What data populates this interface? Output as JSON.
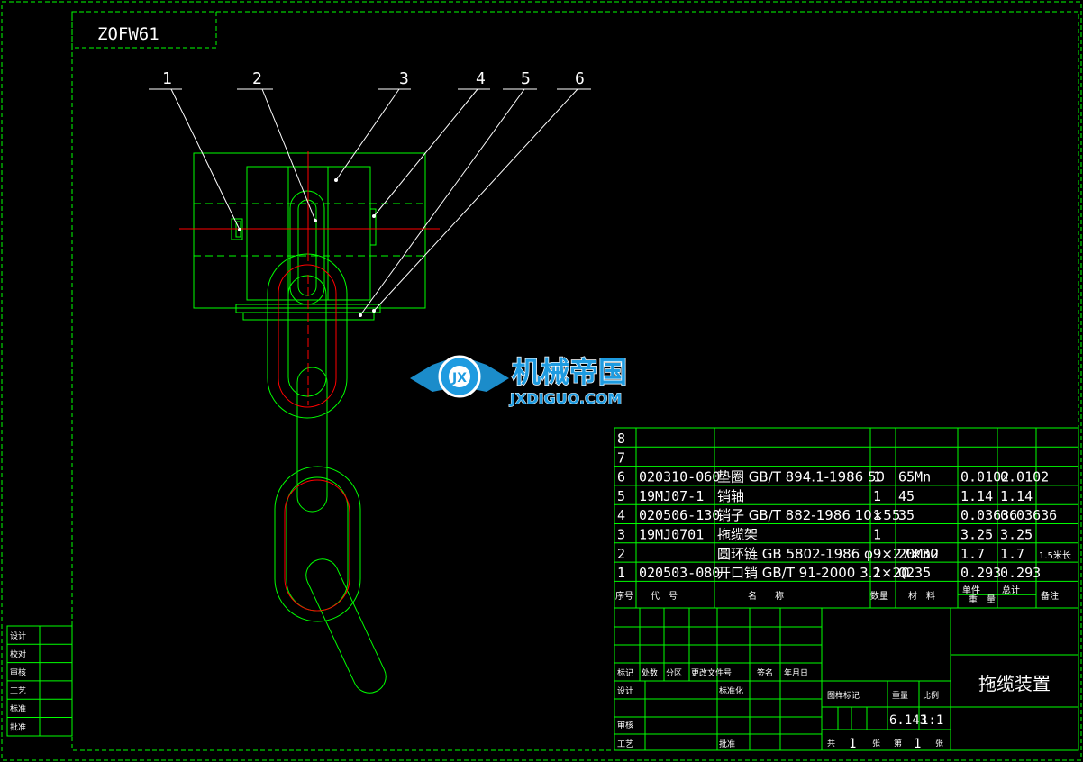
{
  "drawing": {
    "code_box": "ZOFW61",
    "title": "拖缆装置",
    "weight": "6.143",
    "scale": "1:1",
    "sheet_total_label": "共",
    "sheet_total": "1",
    "sheet_label": "张",
    "sheet_no_label": "第",
    "sheet_no": "1",
    "sheet_label2": "张"
  },
  "callouts": [
    "1",
    "2",
    "3",
    "4",
    "5",
    "6"
  ],
  "bom_rows": [
    {
      "no": "8",
      "code": "",
      "name": "",
      "qty": "",
      "material": "",
      "unit_w": "",
      "total_w": "",
      "note": ""
    },
    {
      "no": "7",
      "code": "",
      "name": "",
      "qty": "",
      "material": "",
      "unit_w": "",
      "total_w": "",
      "note": ""
    },
    {
      "no": "6",
      "code": "020310-060",
      "name": "垫圈 GB/T 894.1-1986 50",
      "qty": "1",
      "material": "65Mn",
      "unit_w": "0.0102",
      "total_w": "0.0102",
      "note": ""
    },
    {
      "no": "5",
      "code": "19MJ07-1",
      "name": "销轴",
      "qty": "1",
      "material": "45",
      "unit_w": "1.14",
      "total_w": "1.14",
      "note": ""
    },
    {
      "no": "4",
      "code": "020506-130",
      "name": "销子 GB/T 882-1986 10×55",
      "qty": "1",
      "material": "35",
      "unit_w": "0.03636",
      "total_w": "0.03636",
      "note": ""
    },
    {
      "no": "3",
      "code": "19MJ0701",
      "name": "拖缆架",
      "qty": "1",
      "material": "",
      "unit_w": "3.25",
      "total_w": "3.25",
      "note": ""
    },
    {
      "no": "2",
      "code": "",
      "name": "圆环链 GB 5802-1986 φ9×27×30",
      "qty": "",
      "material": "20Mn2",
      "unit_w": "1.7",
      "total_w": "1.7",
      "note": "1.5米长"
    },
    {
      "no": "1",
      "code": "020503-080",
      "name": "开口销 GB/T 91-2000 3.2×20",
      "qty": "1",
      "material": "Q235",
      "unit_w": "0.293",
      "total_w": "0.293",
      "note": ""
    }
  ],
  "bom_header": {
    "no": "序号",
    "code": "代　号",
    "name": "名　　称",
    "qty": "数量",
    "material": "材　料",
    "unit_w": "单件",
    "total_w": "总计",
    "weight": "重　量",
    "note": "备注"
  },
  "title_block": {
    "mark": "标记",
    "count": "处数",
    "zone": "分区",
    "change_doc": "更改文件号",
    "sign": "签名",
    "date": "年月日",
    "design": "设计",
    "standardize": "标准化",
    "review": "审核",
    "process": "工艺",
    "approve": "批准",
    "stage_mark": "图样标记",
    "weight_label": "重量",
    "scale_label": "比例"
  },
  "left_strip": [
    "设计",
    "校对",
    "审核",
    "工艺",
    "标准",
    "批准"
  ],
  "watermark": {
    "text_cn": "机械帝国",
    "text_en": "JXDIGUO.COM",
    "logo_text": "JX"
  },
  "colors": {
    "line": "#00ff00",
    "centerline": "#ff0000",
    "text": "#ffffff",
    "watermark_blue": "#1e9be0",
    "background": "#000000"
  }
}
